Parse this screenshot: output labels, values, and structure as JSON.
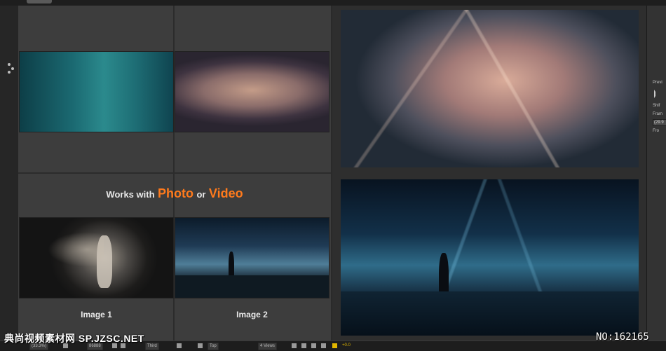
{
  "composition": {
    "headline": {
      "prefix": "Works with",
      "photo": "Photo",
      "middle": "or",
      "video": "Video"
    },
    "captions": {
      "image1_word": "Image",
      "image1_num": "1",
      "image2_word": "Image",
      "image2_num": "2"
    }
  },
  "right_panel": {
    "label_preview": "Previ",
    "label_shift": "Shif",
    "label_frame": "Fram",
    "frame_value": "(29.9",
    "label_from": "Fro"
  },
  "bottom_bar": {
    "zoom": "(33.3%)",
    "timecode": "86888",
    "resolution": "Third",
    "view": "Top",
    "views_count": "4 Views",
    "exposure": "+0.0"
  },
  "watermark": {
    "left": "典尚视频素材网 SP.JZSC.NET",
    "right": "NO:162165"
  },
  "colors": {
    "accent_orange": "#ff7a1c",
    "panel_bg": "#3d3d3d"
  }
}
